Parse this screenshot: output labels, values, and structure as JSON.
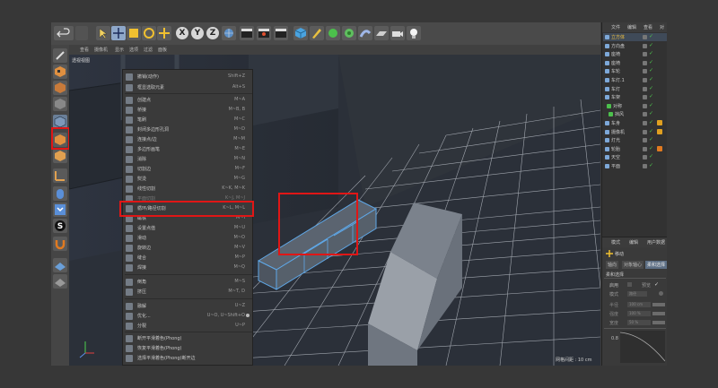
{
  "viewport": {
    "menubar": [
      "查看",
      "摄像机",
      "显示",
      "选项",
      "过滤",
      "面板"
    ],
    "title": "透视视图",
    "grid_spacing": "网格间距 : 10 cm"
  },
  "toolbar": {
    "axes": [
      "X",
      "Y",
      "Z"
    ]
  },
  "context_menu": {
    "items": [
      {
        "label": "撤销(动作)",
        "shortcut": "Shift+Z"
      },
      {
        "label": "框显选取元素",
        "shortcut": "Alt+S"
      },
      {
        "label": "创建点",
        "shortcut": "M~A"
      },
      {
        "label": "桥接",
        "shortcut": "M~B, B"
      },
      {
        "label": "笔刷",
        "shortcut": "M~C"
      },
      {
        "label": "封闭多边形孔洞",
        "shortcut": "M~D"
      },
      {
        "label": "连接点/边",
        "shortcut": "M~M"
      },
      {
        "label": "多边形画笔",
        "shortcut": "M~E"
      },
      {
        "label": "消除",
        "shortcut": "M~N"
      },
      {
        "label": "切割边",
        "shortcut": "M~F"
      },
      {
        "label": "熨烫",
        "shortcut": "M~G"
      },
      {
        "label": "线性切割",
        "shortcut": "K~K, M~K"
      },
      {
        "label": "平面切割",
        "shortcut": "K~J, M~J"
      },
      {
        "label": "循环/路径切割",
        "shortcut": "K~L, M~L"
      },
      {
        "label": "磁铁",
        "shortcut": "M~I"
      },
      {
        "label": "设置点值",
        "shortcut": "M~U"
      },
      {
        "label": "滑动",
        "shortcut": "M~O"
      },
      {
        "label": "旋转边",
        "shortcut": "M~V"
      },
      {
        "label": "缝合",
        "shortcut": "M~P"
      },
      {
        "label": "焊接",
        "shortcut": "M~Q"
      },
      {
        "label": "倒角",
        "shortcut": "M~S"
      },
      {
        "label": "挤压",
        "shortcut": "M~T, D"
      },
      {
        "label": "融解",
        "shortcut": "U~Z"
      },
      {
        "label": "优化...",
        "shortcut": "U~O, U~Shift+O"
      },
      {
        "label": "分裂",
        "shortcut": "U~P"
      },
      {
        "label": "断开平滑着色(Phong)",
        "shortcut": ""
      },
      {
        "label": "恢复平滑着色(Phong)",
        "shortcut": ""
      },
      {
        "label": "选择平滑着色(Phong)断开边",
        "shortcut": ""
      }
    ]
  },
  "object_manager": {
    "tabs": [
      "文件",
      "编辑",
      "查看",
      "对"
    ],
    "objects": [
      "立方体",
      "方向盘",
      "座椅",
      "座椅",
      "车轮",
      "车灯.1",
      "车灯",
      "车架",
      "对称",
      "挡风",
      "车身",
      "摄像机",
      "灯光",
      "轮胎",
      "天空",
      "平面"
    ]
  },
  "attributes": {
    "tabs": [
      "模式",
      "编辑",
      "用户数据"
    ],
    "mode": "移动",
    "subtabs": [
      "轴向",
      "对象轴心",
      "柔和选择"
    ],
    "section": "柔和选择",
    "fields": [
      {
        "label": "启用",
        "value": ""
      },
      {
        "label": "模式",
        "value": "路径"
      },
      {
        "label": "半径",
        "value": "100 cm"
      },
      {
        "label": "强度",
        "value": "100 %"
      },
      {
        "label": "宽度",
        "value": "50 %"
      }
    ],
    "preview_label": "预览",
    "graph_value": "0.8"
  }
}
